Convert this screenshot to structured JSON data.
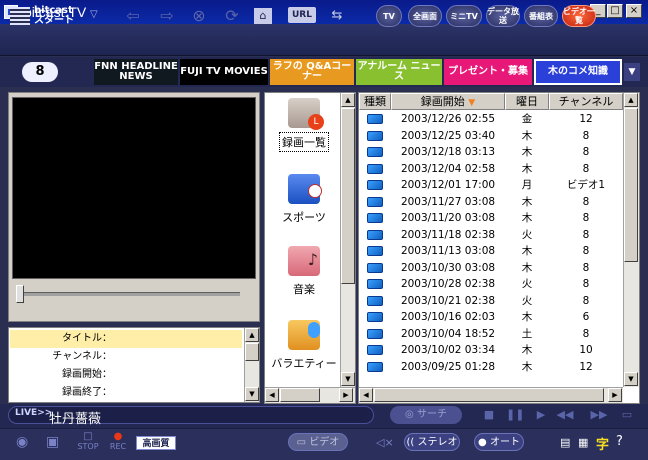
{
  "window": {
    "title": "bitcast.TV"
  },
  "toolbar": {
    "logo_line1": "bitcast",
    "logo_line2": "スタート",
    "url_label": "URL",
    "modes": [
      "TV",
      "全画面",
      "ミニTV",
      "データ放送",
      "番組表",
      "ビデオ一覧"
    ]
  },
  "channel_number": "8",
  "banners": [
    {
      "text": "FNN HEADLINE NEWS",
      "color": "#101820"
    },
    {
      "text": "FUJI TV MOVIES",
      "color": "#000000"
    },
    {
      "text": "ラフの Q&Aコーナー",
      "color": "#e89a20"
    },
    {
      "text": "アナルーム ニュース",
      "color": "#88c030"
    },
    {
      "text": "プレゼント・募集",
      "color": "#e81878"
    },
    {
      "text": "木のコメ知識",
      "color": "#2a40d8"
    }
  ],
  "info": {
    "labels": [
      "タイトル：",
      "チャンネル：",
      "録画開始：",
      "録画終了："
    ]
  },
  "categories": [
    {
      "label": "録画一覧",
      "icon": "folder-clock-icon",
      "color": "#e8e0d8"
    },
    {
      "label": "スポーツ",
      "icon": "folder-sports-icon",
      "color": "#3a70e0"
    },
    {
      "label": "音楽",
      "icon": "folder-music-icon",
      "color": "#e88a90"
    },
    {
      "label": "バラエティー",
      "icon": "folder-variety-icon",
      "color": "#f0b040"
    }
  ],
  "list": {
    "columns": [
      "種類",
      "録画開始",
      "曜日",
      "チャンネル"
    ],
    "rows": [
      [
        "2003/12/26 02:55",
        "金",
        "12"
      ],
      [
        "2003/12/25 03:40",
        "木",
        "8"
      ],
      [
        "2003/12/18 03:13",
        "木",
        "8"
      ],
      [
        "2003/12/04 02:58",
        "木",
        "8"
      ],
      [
        "2003/12/01 17:00",
        "月",
        "ビデオ1"
      ],
      [
        "2003/11/27 03:08",
        "木",
        "8"
      ],
      [
        "2003/11/20 03:08",
        "木",
        "8"
      ],
      [
        "2003/11/18 02:38",
        "火",
        "8"
      ],
      [
        "2003/11/13 03:08",
        "木",
        "8"
      ],
      [
        "2003/10/30 03:08",
        "木",
        "8"
      ],
      [
        "2003/10/28 02:38",
        "火",
        "8"
      ],
      [
        "2003/10/21 02:38",
        "火",
        "8"
      ],
      [
        "2003/10/16 02:03",
        "木",
        "6"
      ],
      [
        "2003/10/04 18:52",
        "土",
        "8"
      ],
      [
        "2003/10/02 03:34",
        "木",
        "10"
      ],
      [
        "2003/09/25 01:28",
        "木",
        "12"
      ]
    ]
  },
  "status": {
    "live_tag": "LIVE>>",
    "live_channel": "牡丹薔薇",
    "search_label": "サーチ"
  },
  "bottom": {
    "stop_label": "STOP",
    "rec_label": "REC",
    "quality_label": "高画質",
    "video_label": "ビデオ",
    "stereo_label": "ステレオ",
    "auto_label": "オート"
  }
}
